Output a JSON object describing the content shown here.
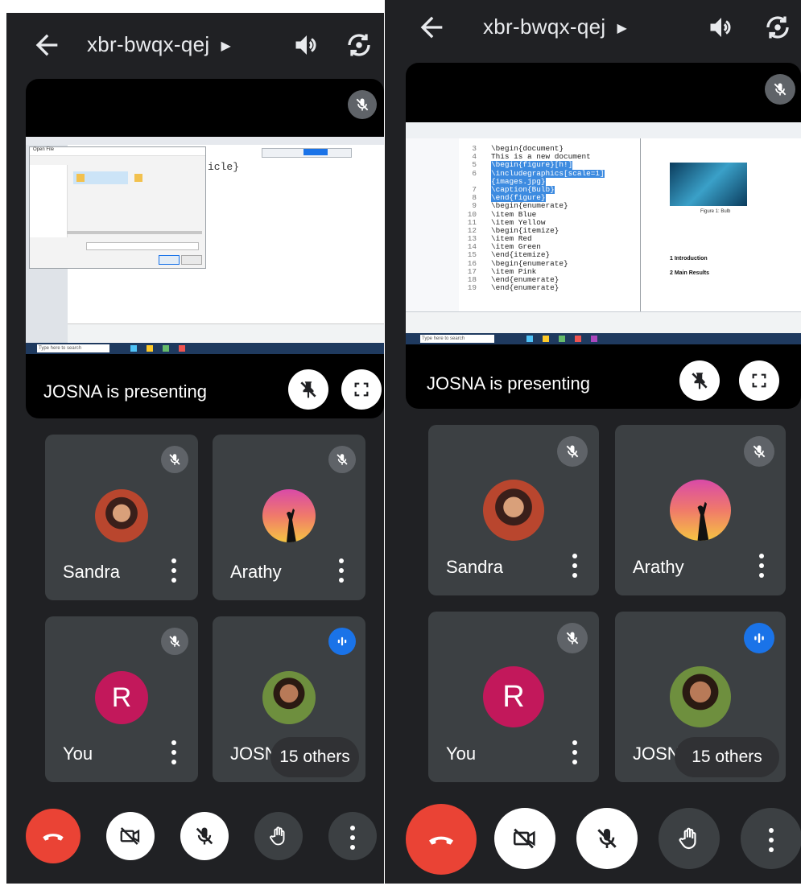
{
  "meeting": {
    "code": "xbr-bwqx-qej"
  },
  "presenting": {
    "label": "JOSNA is presenting"
  },
  "participants": [
    {
      "name": "Sandra",
      "muted": true
    },
    {
      "name": "Arathy",
      "muted": true
    },
    {
      "name": "You",
      "initial": "R",
      "muted": true
    },
    {
      "name": "JOSNA",
      "speaking": true
    }
  ],
  "others_label": "15 others",
  "colors": {
    "background": "#202124",
    "tile": "#3c4043",
    "end_call": "#ea4335",
    "speaking": "#1a73e8",
    "avatar_r": "#c2185b"
  },
  "icons": [
    "back-arrow-icon",
    "speaker-icon",
    "camera-switch-icon",
    "mic-off-icon",
    "unpin-icon",
    "fullscreen-icon",
    "more-vert-icon",
    "end-call-icon",
    "camera-off-icon",
    "raise-hand-icon",
    "speaking-icon"
  ],
  "shared_right": {
    "code_lines": [
      {
        "n": "3",
        "t": "\\begin{document}",
        "hl": false
      },
      {
        "n": "4",
        "t": "This is a new document",
        "hl": false
      },
      {
        "n": "5",
        "t": "\\begin{figure}[h!]",
        "hl": true
      },
      {
        "n": "6",
        "t": "\\includegraphics[scale=1]",
        "hl": true
      },
      {
        "n": "",
        "t": "{images.jpg}",
        "hl": true
      },
      {
        "n": "7",
        "t": "\\caption{Bulb}",
        "hl": true
      },
      {
        "n": "8",
        "t": "\\end{figure}",
        "hl": true
      },
      {
        "n": "9",
        "t": "\\begin{enumerate}",
        "hl": false
      },
      {
        "n": "10",
        "t": "\\item Blue",
        "hl": false
      },
      {
        "n": "11",
        "t": "\\item Yellow",
        "hl": false
      },
      {
        "n": "12",
        "t": "\\begin{itemize}",
        "hl": false
      },
      {
        "n": "13",
        "t": "\\item Red",
        "hl": false
      },
      {
        "n": "14",
        "t": "\\item Green",
        "hl": false
      },
      {
        "n": "15",
        "t": "\\end{itemize}",
        "hl": false
      },
      {
        "n": "16",
        "t": "\\begin{enumerate}",
        "hl": false
      },
      {
        "n": "17",
        "t": "\\item Pink",
        "hl": false
      },
      {
        "n": "18",
        "t": "\\end{enumerate}",
        "hl": false
      },
      {
        "n": "19",
        "t": "\\end{enumerate}",
        "hl": false
      }
    ],
    "preview": {
      "caption": "Figure 1: Bulb",
      "section1": "1 Introduction",
      "section2": "2 Main Results"
    },
    "search_placeholder": "Type here to search"
  },
  "shared_left": {
    "snippet": "icle}",
    "dialog_title": "Open File",
    "open_button": "Open",
    "cancel_button": "Cancel",
    "search_placeholder": "Type here to search"
  }
}
